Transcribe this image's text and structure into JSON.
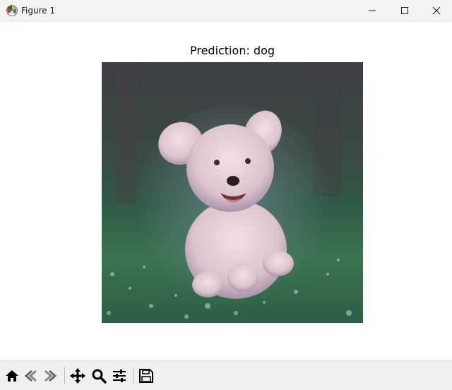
{
  "window": {
    "title": "Figure 1",
    "controls": [
      "minimize",
      "maximize",
      "close"
    ]
  },
  "figure": {
    "title": "Prediction: dog",
    "image": {
      "subject": "fluffy white puppy running on grass",
      "colors": {
        "background_top": "#3e4a44",
        "background_bottom": "#2f6a4a",
        "grass": "#3f7a52",
        "fur": "#e9d2d6",
        "fur_shadow": "#b9a3b8"
      }
    }
  },
  "toolbar": {
    "buttons": [
      {
        "name": "home",
        "icon": "home-icon"
      },
      {
        "name": "back",
        "icon": "back-arrow-icon"
      },
      {
        "name": "forward",
        "icon": "forward-arrow-icon"
      },
      {
        "name": "pan",
        "icon": "move-icon"
      },
      {
        "name": "zoom",
        "icon": "zoom-icon"
      },
      {
        "name": "configure-subplots",
        "icon": "sliders-icon"
      },
      {
        "name": "save",
        "icon": "save-icon"
      }
    ]
  }
}
